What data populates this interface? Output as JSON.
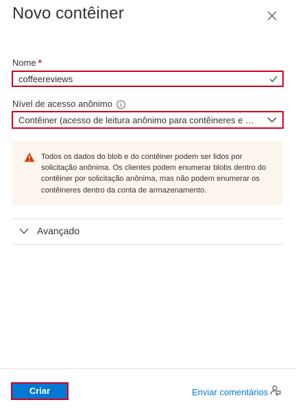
{
  "header": {
    "title": "Novo contêiner",
    "close_icon": "close-icon"
  },
  "name_field": {
    "label": "Nome",
    "required_marker": "*",
    "value": "coffeereviews",
    "valid_icon": "checkmark-icon"
  },
  "access_level": {
    "label": "Nível de acesso anônimo",
    "info_icon": "info-icon",
    "selected": "Contêiner (acesso de leitura anônimo para contêineres e blo...",
    "dropdown_icon": "chevron-down-icon"
  },
  "warning": {
    "icon": "warning-icon",
    "text": "Todos os dados do blob e do contêiner podem ser lidos por solicitação anônima. Os clientes podem enumerar blobs dentro do contêiner por solicitação anônima, mas não podem enumerar os contêineres dentro da conta de armazenamento."
  },
  "advanced": {
    "label": "Avançado",
    "icon": "chevron-down-icon"
  },
  "footer": {
    "create_label": "Criar",
    "feedback_label": "Enviar comentários",
    "feedback_icon": "feedback-icon"
  },
  "colors": {
    "accent": "#0078d4",
    "highlight_border": "#d0021b",
    "warning_bg": "#fdf6ee",
    "warning_icon": "#d83b01",
    "valid_check": "#107c10",
    "required": "#a4262c"
  }
}
